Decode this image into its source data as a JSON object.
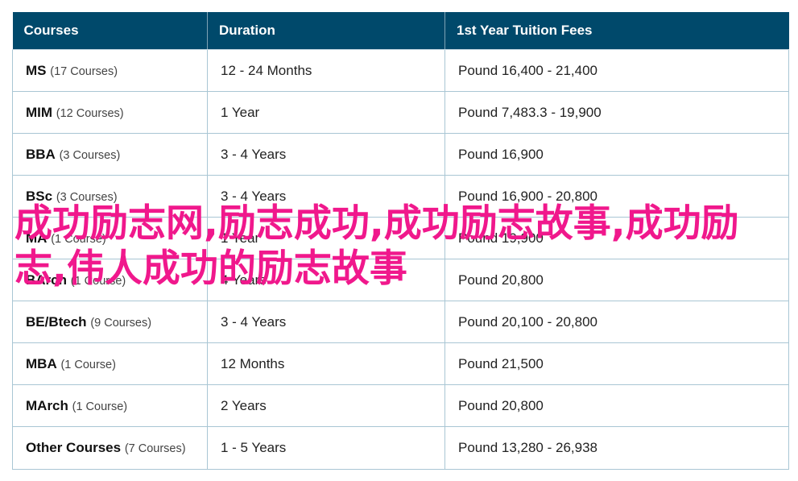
{
  "table": {
    "headers": [
      "Courses",
      "Duration",
      "1st Year Tuition Fees"
    ],
    "rows": [
      {
        "course": "MS",
        "count": "(17 Courses)",
        "duration": "12 - 24 Months",
        "fees": "Pound 16,400 - 21,400"
      },
      {
        "course": "MIM",
        "count": "(12 Courses)",
        "duration": "1 Year",
        "fees": "Pound 7,483.3 - 19,900"
      },
      {
        "course": "BBA",
        "count": "(3 Courses)",
        "duration": "3 - 4 Years",
        "fees": "Pound 16,900"
      },
      {
        "course": "BSc",
        "count": "(3 Courses)",
        "duration": "3 - 4 Years",
        "fees": "Pound 16,900 - 20,800"
      },
      {
        "course": "MA",
        "count": "(1 Course)",
        "duration": "1 Year",
        "fees": "Pound 19,900"
      },
      {
        "course": "BArch",
        "count": "(1 Course)",
        "duration": "4 Years",
        "fees": "Pound 20,800"
      },
      {
        "course": "BE/Btech",
        "count": "(9 Courses)",
        "duration": "3 - 4 Years",
        "fees": "Pound 20,100 - 20,800"
      },
      {
        "course": "MBA",
        "count": "(1 Course)",
        "duration": "12 Months",
        "fees": "Pound 21,500"
      },
      {
        "course": "MArch",
        "count": "(1 Course)",
        "duration": "2 Years",
        "fees": "Pound 20,800"
      },
      {
        "course": "Other Courses",
        "count": "(7 Courses)",
        "duration": "1 - 5 Years",
        "fees": "Pound 13,280 - 26,938"
      }
    ]
  },
  "overlay_text": "成功励志网,励志成功,成功励志故事,成功励志,伟人成功的励志故事",
  "colors": {
    "header_bg": "#00496b",
    "border": "#a9c6d4",
    "overlay": "#f0188c"
  }
}
